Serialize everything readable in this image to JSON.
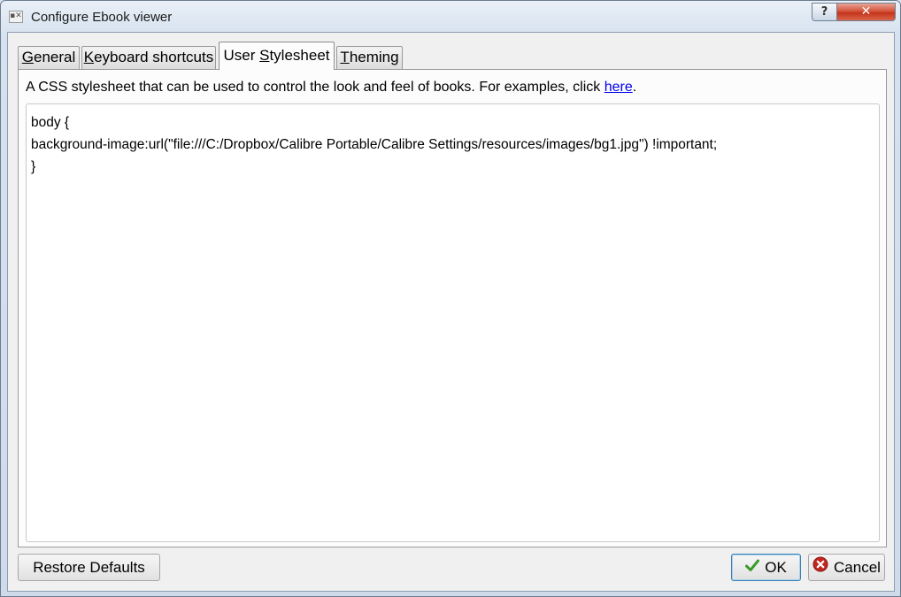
{
  "window": {
    "title": "Configure Ebook viewer",
    "help_label": "?",
    "close_label": "✕"
  },
  "tabs": [
    {
      "label": "General",
      "mnemonic": "G",
      "active": false
    },
    {
      "label": "Keyboard shortcuts",
      "mnemonic": "K",
      "active": false
    },
    {
      "label": "User Stylesheet",
      "mnemonic": "S",
      "active": true
    },
    {
      "label": "Theming",
      "mnemonic": "T",
      "active": false
    }
  ],
  "stylesheet": {
    "description_prefix": "A CSS stylesheet that can be used to control the look and feel of books. For examples, click ",
    "link_text": "here",
    "description_suffix": ".",
    "code_lines": [
      "body {",
      "background-image:url(\"file:///C:/Dropbox/Calibre Portable/Calibre Settings/resources/images/bg1.jpg\") !important;",
      "}"
    ]
  },
  "buttons": {
    "restore_defaults": "Restore Defaults",
    "ok": "OK",
    "cancel": "Cancel"
  },
  "colors": {
    "ok_check": "#3a9b2a",
    "cancel_icon": "#c0271f",
    "link": "#0000ee",
    "close_button": "#c4341a"
  }
}
